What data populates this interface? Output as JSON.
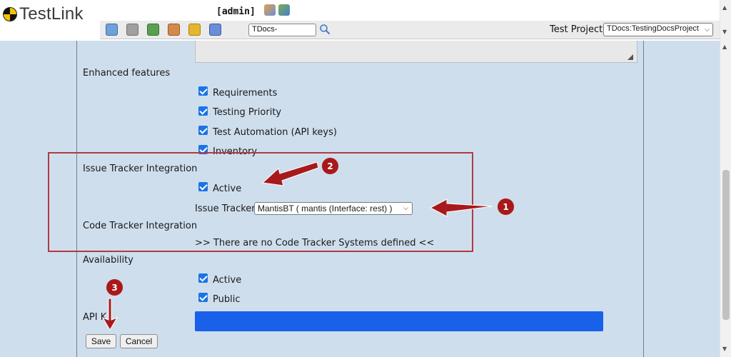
{
  "app": {
    "name": "TestLink",
    "user": "[admin]"
  },
  "toolbar": {
    "search_value": "TDocs-",
    "project_label": "Test Project",
    "project_value": "TDocs:TestingDocsProject"
  },
  "form": {
    "enhanced_features": {
      "label": "Enhanced features",
      "options": [
        "Requirements",
        "Testing Priority",
        "Test Automation (API keys)",
        "Inventory"
      ]
    },
    "issue_tracker": {
      "label": "Issue Tracker Integration",
      "active_label": "Active",
      "tracker_label": "Issue Tracker",
      "tracker_value": "MantisBT ( mantis (Interface: rest) )"
    },
    "code_tracker": {
      "label": "Code Tracker Integration",
      "message": ">> There are no Code Tracker Systems defined <<"
    },
    "availability": {
      "label": "Availability",
      "options": [
        "Active",
        "Public"
      ]
    },
    "api_key_label": "API K",
    "buttons": {
      "save": "Save",
      "cancel": "Cancel"
    }
  },
  "annotations": {
    "badges": [
      "1",
      "2",
      "3"
    ],
    "color": "#a8191c"
  }
}
